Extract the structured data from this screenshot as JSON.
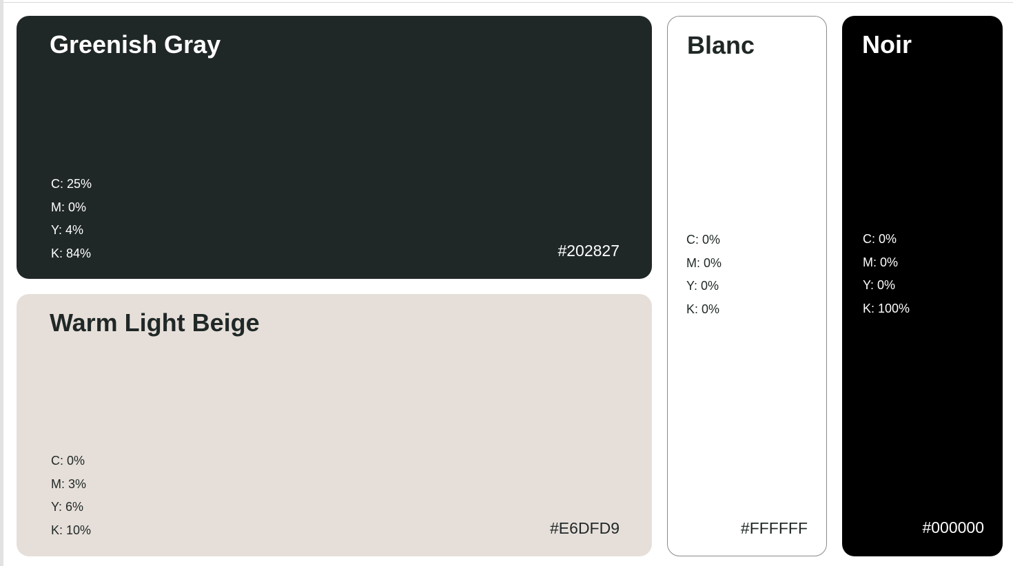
{
  "swatches": {
    "greenish_gray": {
      "name": "Greenish Gray",
      "background": "#202827",
      "text_color": "#ffffff",
      "cmyk": [
        "C: 25%",
        "M: 0%",
        "Y: 4%",
        "K: 84%"
      ],
      "hex": "#202827"
    },
    "warm_light_beige": {
      "name": "Warm Light Beige",
      "background": "#E6DFD9",
      "text_color": "#202827",
      "cmyk": [
        "C: 0%",
        "M: 3%",
        "Y: 6%",
        "K: 10%"
      ],
      "hex": "#E6DFD9"
    },
    "blanc": {
      "name": "Blanc",
      "background": "#FFFFFF",
      "text_color": "#202827",
      "cmyk": [
        "C: 0%",
        "M: 0%",
        "Y: 0%",
        "K: 0%"
      ],
      "hex": "#FFFFFF"
    },
    "noir": {
      "name": "Noir",
      "background": "#000000",
      "text_color": "#ffffff",
      "cmyk": [
        "C: 0%",
        "M: 0%",
        "Y: 0%",
        "K: 100%"
      ],
      "hex": "#000000"
    }
  }
}
